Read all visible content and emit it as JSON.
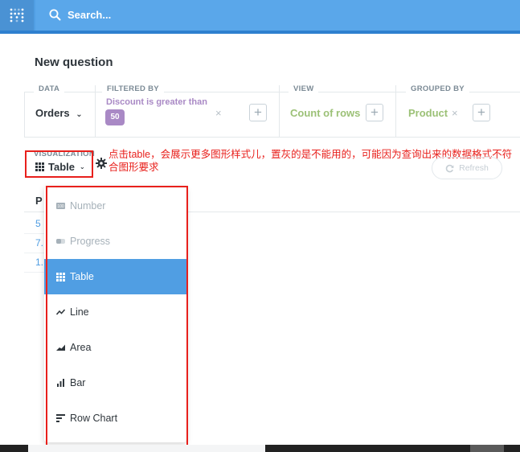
{
  "topbar": {
    "search_placeholder": "Search..."
  },
  "page": {
    "title": "New question"
  },
  "query_builder": {
    "data": {
      "label": "DATA",
      "value": "Orders",
      "chevron": "⌄"
    },
    "filter": {
      "label": "FILTERED BY",
      "text": "Discount is greater than",
      "badge": "50",
      "remove": "×",
      "add": "+"
    },
    "view": {
      "label": "VIEW",
      "value": "Count of rows",
      "add": "+"
    },
    "group": {
      "label": "GROUPED BY",
      "value": "Product",
      "remove": "×",
      "add": "+"
    }
  },
  "visualization": {
    "label": "VISUALIZATION",
    "current": "Table",
    "chevron": "⌄",
    "refresh_label": "Refresh",
    "annotation": "点击table，会展示更多图形样式儿，置灰的是不能用的，可能因为查询出来的数据格式不符合图形要求"
  },
  "background_table": {
    "header": "P",
    "cells": [
      "5",
      "7.",
      "1."
    ]
  },
  "dropdown": {
    "items": [
      {
        "label": "Number",
        "icon": "number-icon",
        "disabled": true
      },
      {
        "label": "Progress",
        "icon": "progress-icon",
        "disabled": true
      },
      {
        "label": "Table",
        "icon": "table-icon",
        "selected": true
      },
      {
        "label": "Line",
        "icon": "line-chart-icon"
      },
      {
        "label": "Area",
        "icon": "area-chart-icon"
      },
      {
        "label": "Bar",
        "icon": "bar-chart-icon"
      },
      {
        "label": "Row Chart",
        "icon": "row-chart-icon"
      }
    ]
  },
  "colors": {
    "brand": "#509ee3",
    "filter_purple": "#a989c5",
    "view_green": "#9cc177",
    "annotation_red": "#e8201c"
  }
}
